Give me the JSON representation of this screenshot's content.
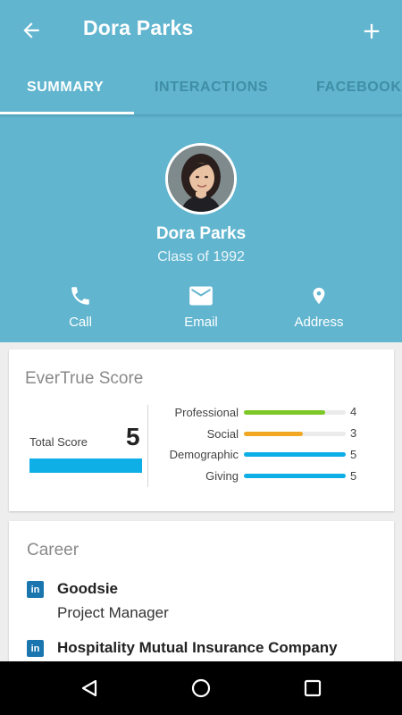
{
  "header": {
    "title": "Dora Parks",
    "back_icon": "arrow-left-icon",
    "add_icon": "plus-icon"
  },
  "tabs": [
    {
      "label": "SUMMARY",
      "active": true
    },
    {
      "label": "INTERACTIONS",
      "active": false
    },
    {
      "label": "FACEBOOK",
      "active": false
    }
  ],
  "profile": {
    "name": "Dora Parks",
    "class_year": "Class of 1992",
    "actions": [
      {
        "label": "Call",
        "icon": "phone-icon"
      },
      {
        "label": "Email",
        "icon": "email-icon"
      },
      {
        "label": "Address",
        "icon": "map-pin-icon"
      }
    ]
  },
  "score": {
    "title": "EverTrue Score",
    "total_label": "Total Score",
    "total_value": "5",
    "metrics": [
      {
        "label": "Professional",
        "value": "4",
        "fill": 0.8,
        "color": "#7dc828"
      },
      {
        "label": "Social",
        "value": "3",
        "fill": 0.58,
        "color": "#f2a722"
      },
      {
        "label": "Demographic",
        "value": "5",
        "fill": 1.0,
        "color": "#0eaee6"
      },
      {
        "label": "Giving",
        "value": "5",
        "fill": 1.0,
        "color": "#0eaee6"
      }
    ]
  },
  "career": {
    "title": "Career",
    "entries": [
      {
        "company": "Goodsie",
        "role": "Project Manager",
        "icon": "linkedin-icon",
        "icon_text": "in"
      },
      {
        "company": "Hospitality Mutual Insurance Company",
        "role": "",
        "icon": "linkedin-icon",
        "icon_text": "in"
      }
    ]
  },
  "colors": {
    "primary": "#61b5cf",
    "score_blue": "#0eaee6",
    "linkedin": "#1b76b0"
  },
  "system_nav": [
    "back-triangle-icon",
    "home-circle-icon",
    "recents-square-icon"
  ]
}
